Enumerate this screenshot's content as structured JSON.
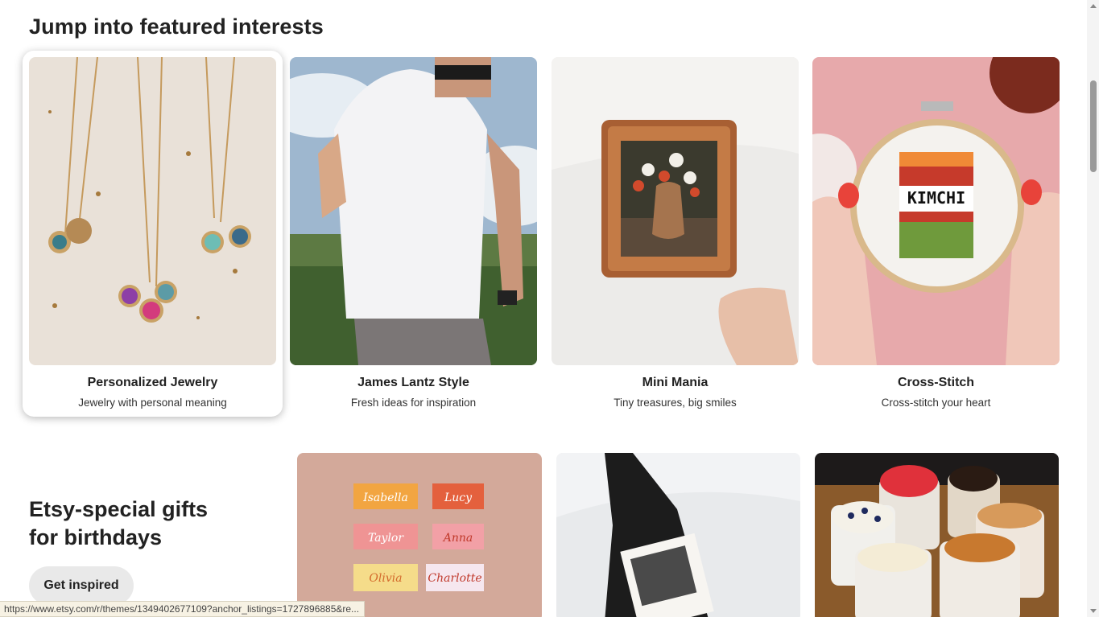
{
  "featured": {
    "title": "Jump into featured interests",
    "cards": [
      {
        "name": "Personalized Jewelry",
        "subtitle": "Jewelry with personal meaning"
      },
      {
        "name": "James Lantz Style",
        "subtitle": "Fresh ideas for inspiration"
      },
      {
        "name": "Mini Mania",
        "subtitle": "Tiny treasures, big smiles"
      },
      {
        "name": "Cross-Stitch",
        "subtitle": "Cross-stitch your heart"
      }
    ]
  },
  "promo": {
    "title_line1": "Etsy-special gifts",
    "title_line2": "for birthdays",
    "button_label": "Get inspired"
  },
  "gift_images": {
    "name_tags": [
      "Isabella",
      "Lucy",
      "Taylor",
      "Anna",
      "Olivia",
      "Charlotte"
    ]
  },
  "cross_stitch_text": "KIMCHI",
  "status_url": "https://www.etsy.com/r/themes/1349402677109?anchor_listings=1727896885&re..."
}
